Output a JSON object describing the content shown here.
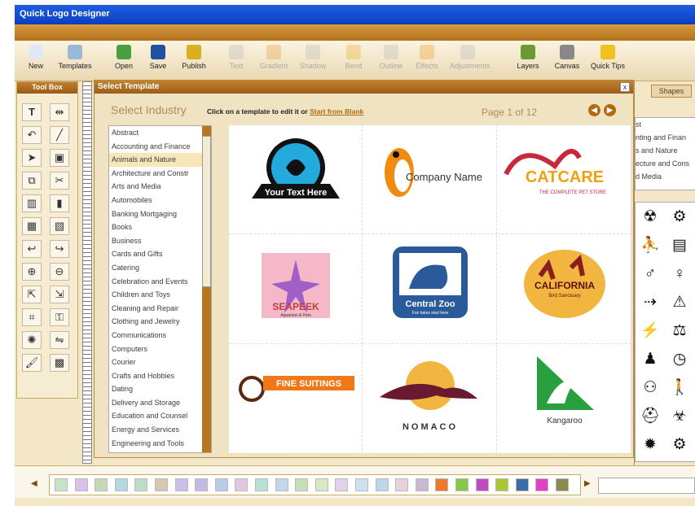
{
  "app": {
    "title": "Quick Logo Designer"
  },
  "toolbar": {
    "buttons": [
      {
        "label": "New",
        "icon": "new-file-icon",
        "enabled": true
      },
      {
        "label": "Templates",
        "icon": "templates-icon",
        "enabled": true
      },
      {
        "label": "Open",
        "icon": "open-folder-icon",
        "enabled": true
      },
      {
        "label": "Save",
        "icon": "save-disk-icon",
        "enabled": true
      },
      {
        "label": "Publish",
        "icon": "publish-icon",
        "enabled": true
      },
      {
        "label": "Text",
        "icon": "text-icon",
        "enabled": false
      },
      {
        "label": "Gradient",
        "icon": "gradient-icon",
        "enabled": false
      },
      {
        "label": "Shadow",
        "icon": "shadow-icon",
        "enabled": false
      },
      {
        "label": "Bend",
        "icon": "bend-icon",
        "enabled": false
      },
      {
        "label": "Outline",
        "icon": "outline-icon",
        "enabled": false
      },
      {
        "label": "Effects",
        "icon": "effects-icon",
        "enabled": false
      },
      {
        "label": "Adjustments",
        "icon": "adjustments-icon",
        "enabled": false
      },
      {
        "label": "Layers",
        "icon": "layers-icon",
        "enabled": true
      },
      {
        "label": "Canvas",
        "icon": "canvas-icon",
        "enabled": true
      },
      {
        "label": "Quick Tips",
        "icon": "lightbulb-icon",
        "enabled": true
      }
    ]
  },
  "toolbox": {
    "title": "Tool Box"
  },
  "dialog": {
    "title": "Select Template",
    "close": "x",
    "heading": "Select Industry",
    "instruction": "Click on a template to edit it or",
    "start_link": "Start from Blank",
    "page_info": "Page 1 of 12",
    "prev": "◀",
    "next": "▶",
    "industries": [
      "Abstract",
      "Accounting and Finance",
      "Animals and Nature",
      "Architecture and Constr",
      "Arts and Media",
      "Automobiles",
      "Banking Mortgaging",
      "Books",
      "Business",
      "Cards and Gifts",
      "Catering",
      "Celebration and Events",
      "Children and Toys",
      "Cleaning and Repair",
      "Clothing and Jewelry",
      "Communications",
      "Computers",
      "Courier",
      "Crafts and Hobbies",
      "Dating",
      "Delivery and Storage",
      "Education and Counsel",
      "Energy and Services",
      "Engineering and Tools"
    ],
    "selected_industry": "Animals and Nature",
    "templates": [
      {
        "name": "scorpion-logo",
        "text": "Your Text Here"
      },
      {
        "name": "penguin-logo",
        "text": "Company Name"
      },
      {
        "name": "catcare-logo",
        "text": "CATCARE",
        "subtext": "THE COMPLETE PET STORE"
      },
      {
        "name": "seapeek-logo",
        "text": "SEAPEEK",
        "subtext": "Aquarium & Pets"
      },
      {
        "name": "central-zoo-logo",
        "text": "Central Zoo",
        "subtext": "Fun takes start here"
      },
      {
        "name": "california-logo",
        "text": "CALIFORNIA",
        "subtext": "Bird Sanctuary"
      },
      {
        "name": "fine-suitings-logo",
        "text": "FINE SUITINGS"
      },
      {
        "name": "nomaco-logo",
        "text": "NOMACO"
      },
      {
        "name": "kangaroo-logo",
        "text": "Kangaroo"
      }
    ]
  },
  "right_panel": {
    "tab": "Shapes",
    "list": [
      "st",
      "nting and Finan",
      "s and Nature",
      "ecture and Cons",
      "d Media"
    ],
    "symbols": [
      "☢",
      "⚙",
      "⛹",
      "▤",
      "♂",
      "♀",
      "⇢",
      "⚠",
      "⚡",
      "⚖",
      "♟",
      "◷",
      "⚇",
      "🚶",
      "⛑",
      "☣",
      "✹",
      "⚙"
    ]
  },
  "palette": {
    "colors": [
      "#c8e4c8",
      "#d6c2e8",
      "#c8d8b4",
      "#b4d8e0",
      "#c0dcc8",
      "#d4c8b0",
      "#ccc0e8",
      "#c4b8e4",
      "#b8cce8",
      "#e0c8e0",
      "#b8e0d8",
      "#c0d8e8",
      "#c4e0b8",
      "#d8e8c0",
      "#e4d0e8",
      "#d0e0f0",
      "#bcd8e8",
      "#e8d0dc",
      "#c8b8d0",
      "#f07828",
      "#88c848",
      "#c048c0",
      "#a8c830",
      "#3c6ca8",
      "#e040c8",
      "#8a8a4a"
    ]
  }
}
